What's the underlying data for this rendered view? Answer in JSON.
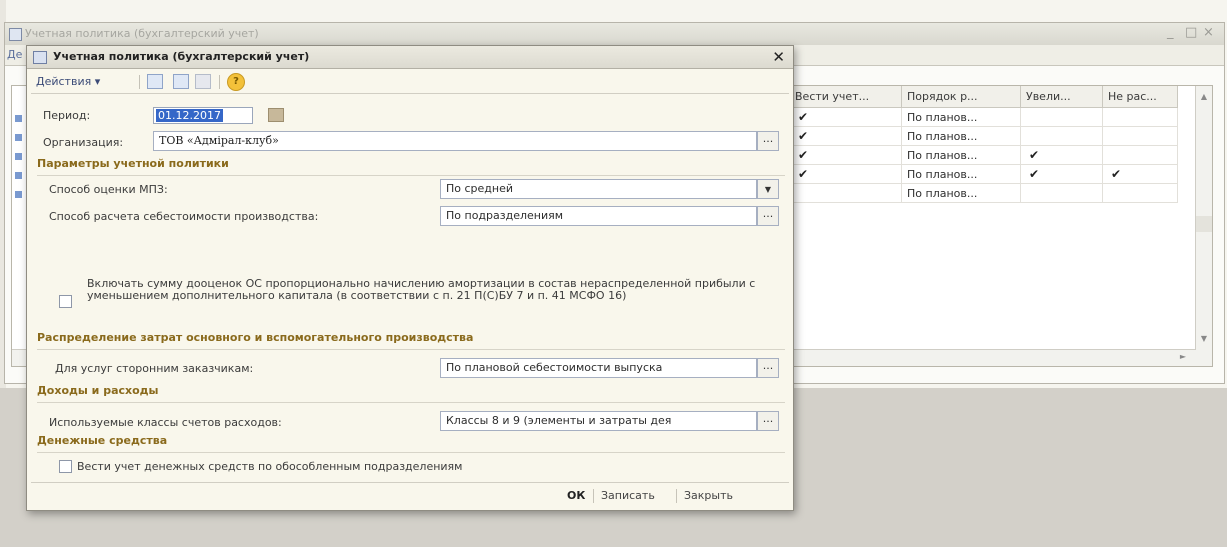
{
  "background_window": {
    "title": "Учетная политика (бухгалтерский учет)",
    "menu": "Де",
    "controls": [
      "_",
      "□",
      "×"
    ],
    "columns": [
      "Вести учет...",
      "Порядок р...",
      "Увели...",
      "Не рас..."
    ],
    "rows": [
      {
        "vesti": true,
        "poryadok": "По планов...",
        "uvel": false,
        "neras": false
      },
      {
        "vesti": true,
        "poryadok": "По планов...",
        "uvel": false,
        "neras": false
      },
      {
        "vesti": true,
        "poryadok": "По планов...",
        "uvel": true,
        "neras": false
      },
      {
        "vesti": true,
        "poryadok": "По планов...",
        "uvel": true,
        "neras": true
      },
      {
        "vesti": false,
        "poryadok": "По планов...",
        "uvel": false,
        "neras": false
      }
    ],
    "check_glyph": "✔"
  },
  "dialog": {
    "title": "Учетная политика (бухгалтерский учет)",
    "close": "✕",
    "toolbar": {
      "actions": "Действия ▾",
      "help": "?"
    },
    "period_label": "Период:",
    "period_value": "01.12.2017",
    "org_label": "Организация:",
    "org_value": "ТОВ «Адмірал-клуб»",
    "ellipsis": "...",
    "section_params": "Параметры учетной политики",
    "mpz_label": "Способ оценки МПЗ:",
    "mpz_value": "По средней",
    "cost_label": "Способ расчета себестоимости производства:",
    "cost_value": "По подразделениям",
    "revaluation_text": "Включать сумму дооценок ОС пропорционально начислению амортизации в состав нераспределенной прибыли с уменьшением дополнительного капитала (в соответствии с п. 21 П(С)БУ 7 и п. 41 МСФО 16)",
    "revaluation_checked": false,
    "section_costs": "Распределение затрат основного и вспомогательного производства",
    "services_label": "Для услуг сторонним заказчикам:",
    "services_value": "По плановой себестоимости выпуска",
    "section_income": "Доходы и расходы",
    "classes_label": "Используемые классы счетов расходов:",
    "classes_value": "Классы 8 и 9 (элементы и затраты дея",
    "section_cash": "Денежные средства",
    "cash_label": "Вести учет денежных средств по обособленным подразделениям",
    "cash_checked": false,
    "buttons": {
      "ok": "ОК",
      "save": "Записать",
      "close": "Закрыть"
    }
  }
}
